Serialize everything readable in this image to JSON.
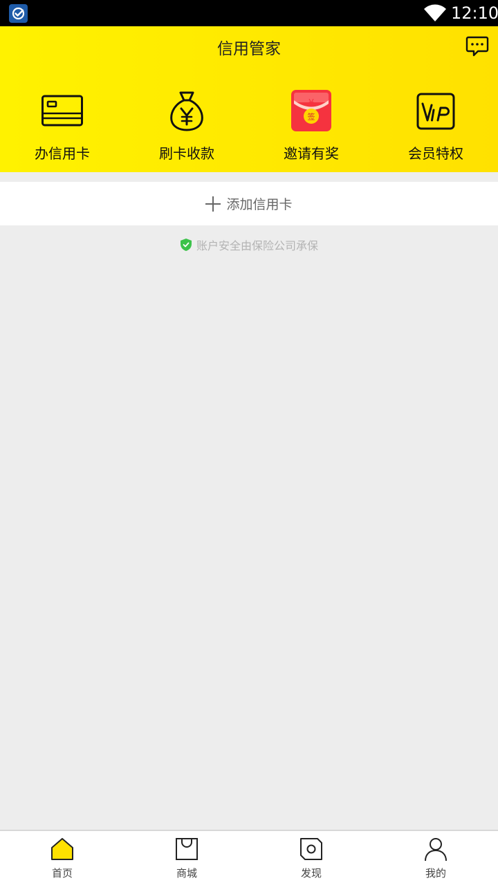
{
  "status_bar": {
    "time": "12:10"
  },
  "header": {
    "title": "信用管家"
  },
  "features": [
    {
      "label": "办信用卡",
      "icon": "credit-card-icon"
    },
    {
      "label": "刷卡收款",
      "icon": "money-bag-icon"
    },
    {
      "label": "邀请有奖",
      "icon": "red-envelope-icon"
    },
    {
      "label": "会员特权",
      "icon": "vip-icon"
    }
  ],
  "red_envelope": {
    "currency": "¥",
    "seal": "签"
  },
  "vip_badge": {
    "text": "VIP"
  },
  "add_card": {
    "label": "添加信用卡"
  },
  "security": {
    "text": "账户安全由保险公司承保"
  },
  "tabs": [
    {
      "label": "首页",
      "icon": "home-icon",
      "active": true
    },
    {
      "label": "商城",
      "icon": "shopping-bag-icon"
    },
    {
      "label": "发现",
      "icon": "discover-icon"
    },
    {
      "label": "我的",
      "icon": "profile-icon"
    }
  ],
  "colors": {
    "header_start": "#fff200",
    "header_end": "#ffe100",
    "accent_yellow": "#ffe100",
    "envelope_red": "#f5333f",
    "shield_green": "#3cc24a"
  }
}
